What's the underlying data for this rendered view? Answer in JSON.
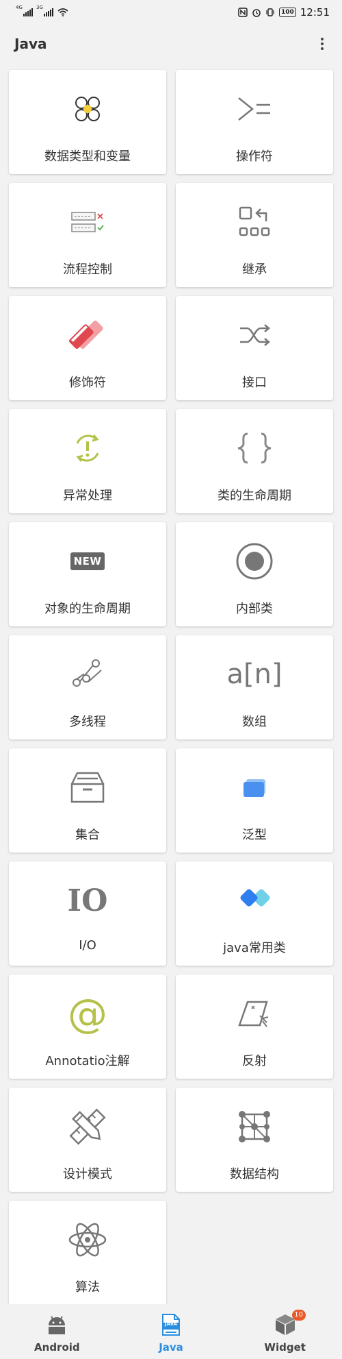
{
  "status_bar": {
    "signal1_tag": "4G",
    "signal2_tag": "3G",
    "battery": "100",
    "time": "12:51"
  },
  "appbar": {
    "title": "Java"
  },
  "cards": [
    {
      "label": "数据类型和变量",
      "icon": "flower-icon"
    },
    {
      "label": "操作符",
      "icon": "greater-equal-icon"
    },
    {
      "label": "流程控制",
      "icon": "checklist-icon"
    },
    {
      "label": "继承",
      "icon": "inherit-icon"
    },
    {
      "label": "修饰符",
      "icon": "eraser-icon"
    },
    {
      "label": "接口",
      "icon": "shuffle-icon"
    },
    {
      "label": "异常处理",
      "icon": "exception-sync-icon"
    },
    {
      "label": "类的生命周期",
      "icon": "braces-icon"
    },
    {
      "label": "对象的生命周期",
      "icon": "new-icon",
      "icon_text": "NEW"
    },
    {
      "label": "内部类",
      "icon": "radio-icon"
    },
    {
      "label": "多线程",
      "icon": "thread-icon"
    },
    {
      "label": "数组",
      "icon": "array-icon",
      "icon_text": "a[n]"
    },
    {
      "label": "集合",
      "icon": "archive-icon"
    },
    {
      "label": "泛型",
      "icon": "layers-icon"
    },
    {
      "label": "I/O",
      "icon": "io-icon",
      "icon_text": "IO"
    },
    {
      "label": "java常用类",
      "icon": "diamond-icon"
    },
    {
      "label": "Annotatio注解",
      "icon": "at-icon",
      "icon_text": "@"
    },
    {
      "label": "反射",
      "icon": "reflect-icon"
    },
    {
      "label": "设计模式",
      "icon": "ruler-pencil-icon"
    },
    {
      "label": "数据结构",
      "icon": "structure-icon"
    },
    {
      "label": "算法",
      "icon": "atom-icon"
    }
  ],
  "bottom_nav": [
    {
      "label": "Android",
      "icon": "android-icon"
    },
    {
      "label": "Java",
      "icon": "java-file-icon",
      "icon_text": "JAVA"
    },
    {
      "label": "Widget",
      "icon": "cube-icon",
      "badge": "10"
    }
  ],
  "colors": {
    "active_tab": "#2a8ee0",
    "icon_gray": "#777777",
    "red": "#e0484f",
    "olive": "#b5c24a",
    "blue": "#4a90f0",
    "badge": "#e85a2a"
  }
}
